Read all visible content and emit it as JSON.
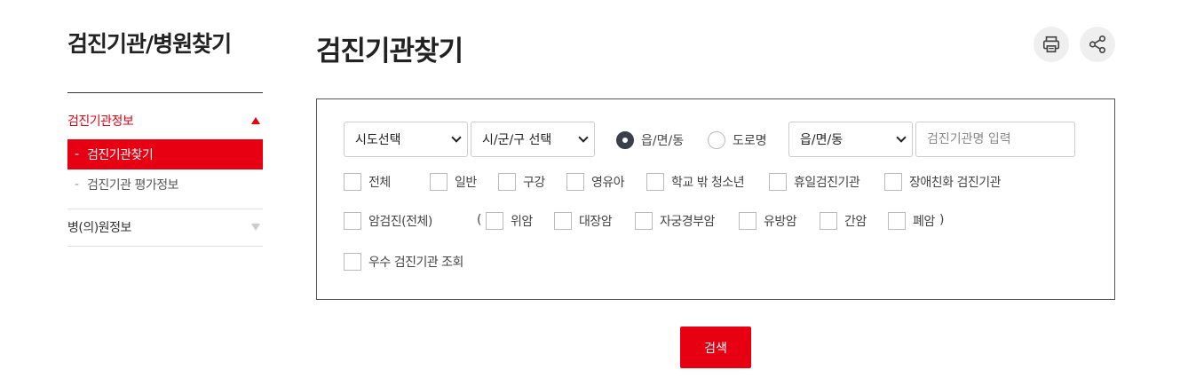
{
  "sidebar": {
    "title": "검진기관/병원찾기",
    "groups": [
      {
        "label": "검진기관정보",
        "expanded": true,
        "items": [
          {
            "label": "검진기관찾기",
            "selected": true
          },
          {
            "label": "검진기관 평가정보",
            "selected": false
          }
        ]
      },
      {
        "label": "병(의)원정보",
        "expanded": false
      }
    ],
    "dash": "-"
  },
  "main": {
    "title": "검진기관찾기",
    "actions": {
      "print_icon": "print-icon",
      "share_icon": "share-icon"
    }
  },
  "search": {
    "sido_select": "시도선택",
    "sigungu_select": "시/군/구 선택",
    "address_type": {
      "options": [
        "읍/면/동",
        "도로명"
      ],
      "selected": "읍/면/동"
    },
    "dong_select": "읍/면/동",
    "name_input": {
      "value": "",
      "placeholder": "검진기관명 입력"
    },
    "types_row1": [
      "전체",
      "일반",
      "구강",
      "영유아",
      "학교 밖 청소년",
      "휴일검진기관",
      "장애친화 검진기관"
    ],
    "cancer_all": "암검진(전체)",
    "paren_open": "(",
    "paren_close": ")",
    "cancer_types": [
      "위암",
      "대장암",
      "자궁경부암",
      "유방암",
      "간암",
      "폐암"
    ],
    "excellent": "우수 검진기관 조회",
    "submit_label": "검색"
  },
  "colors": {
    "accent": "#e60012",
    "radio_on": "#3a3f4b"
  }
}
